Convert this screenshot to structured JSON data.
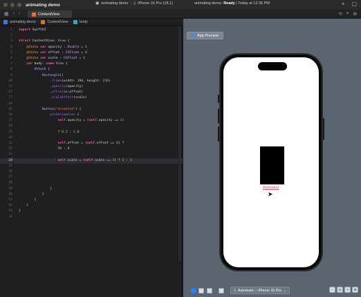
{
  "titlebar": {
    "app_title": "animating demo",
    "scheme_project": "animating demo",
    "scheme_device": "iPhone 16 Pro (18.1)",
    "status_prefix": "animating demo: ",
    "status_state": "Ready",
    "status_suffix": " | Today at 12:36 PM",
    "add_label": "+"
  },
  "tab": {
    "label": "ContentView"
  },
  "breadcrumb": {
    "project": "animating demo",
    "file": "ContentView",
    "symbol": "body"
  },
  "editor": {
    "current_line": 24,
    "lines": [
      {
        "n": "1",
        "html": "<span class=\"kw\">import</span> SwiftUI"
      },
      {
        "n": "2",
        "html": ""
      },
      {
        "n": "3",
        "html": "<span class=\"kw\">struct</span> ContentView: <span class=\"ty\">View</span> {"
      },
      {
        "n": "4",
        "html": "    <span class=\"attr\">@State</span> <span class=\"kw\">var</span> opacity : <span class=\"ty\">Double</span> = <span class=\"num\">1</span>"
      },
      {
        "n": "5",
        "html": "    <span class=\"attr\">@State</span> <span class=\"kw\">var</span> offset : <span class=\"ty\">CGFloat</span> = <span class=\"num\">0</span>"
      },
      {
        "n": "6",
        "html": "    <span class=\"attr\">@State</span> <span class=\"kw\">var</span> scale : <span class=\"ty\">CGFloat</span> = <span class=\"num\">1</span>"
      },
      {
        "n": "7",
        "html": "    <span class=\"kw\">var</span> body: <span class=\"kw\">some</span> <span class=\"ty\">View</span> {"
      },
      {
        "n": "8",
        "html": "        <span class=\"ty\">VStack</span> {"
      },
      {
        "n": "9",
        "html": "            <span class=\"ty\">Rectangle</span>()"
      },
      {
        "n": "10",
        "html": "                .<span class=\"prop\">frame</span>(width: <span class=\"num\">100</span>, height: <span class=\"num\">150</span>)"
      },
      {
        "n": "11",
        "html": "                .<span class=\"prop\">opacity</span>(opacity)"
      },
      {
        "n": "12",
        "html": "                .<span class=\"prop\">offset</span>(x:offset)"
      },
      {
        "n": "13",
        "html": "                .<span class=\"prop\">scaleEffect</span>(scale)"
      },
      {
        "n": "14",
        "html": ""
      },
      {
        "n": "15",
        "html": "            <span class=\"ty\">Button</span>(<span class=\"str\">\"Animated\"</span>) {"
      },
      {
        "n": "16",
        "html": "                <span class=\"prop\">withAnimation</span> {"
      },
      {
        "n": "17",
        "html": "                    <span class=\"kw\">self</span>.opacity = (<span class=\"kw\">self</span>.opacity == <span class=\"num\">1</span>)"
      },
      {
        "n": "18",
        "html": ""
      },
      {
        "n": "19",
        "html": "                    ? <span class=\"num\">0.2</span> : <span class=\"num\">1.0</span>"
      },
      {
        "n": "20",
        "html": ""
      },
      {
        "n": "21",
        "html": "                    <span class=\"kw\">self</span>.offset = (<span class=\"kw\">self</span>.offset == <span class=\"num\">0</span>) ?"
      },
      {
        "n": "22",
        "html": "                    <span class=\"num\">50</span> : <span class=\"num\">0</span>"
      },
      {
        "n": "23",
        "html": ""
      },
      {
        "n": "24",
        "html": "                    <span class=\"kw\">self</span>.scale = (<span class=\"kw\">self</span>.scale == <span class=\"num\">1</span>) ? <span class=\"num\">2</span> : <span class=\"num\">1</span>"
      },
      {
        "n": "25",
        "html": ""
      },
      {
        "n": "26",
        "html": ""
      },
      {
        "n": "27",
        "html": ""
      },
      {
        "n": "28",
        "html": ""
      },
      {
        "n": "29",
        "html": "                }"
      },
      {
        "n": "30",
        "html": "            }"
      },
      {
        "n": "31",
        "html": "        }"
      },
      {
        "n": "32",
        "html": "    }"
      },
      {
        "n": "33",
        "html": "}"
      },
      {
        "n": "34",
        "html": ""
      }
    ]
  },
  "preview": {
    "mode_button": "App Preview",
    "button_label": "Animated",
    "device_selector": "Automatic – iPhone 16 Pro",
    "accent_color": "#ff3b5c",
    "canvas_color": "#5b6470"
  }
}
